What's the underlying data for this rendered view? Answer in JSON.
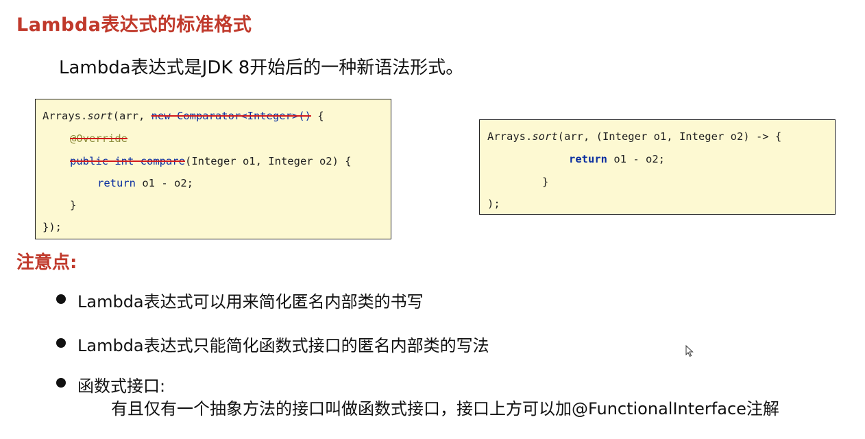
{
  "heading": "Lambda表达式的标准格式",
  "intro": "Lambda表达式是JDK 8开始后的一种新语法形式。",
  "code_left": {
    "l1_a": "Arrays.",
    "l1_sort": "sort",
    "l1_b": "(arr, ",
    "l1_strike": "new Comparator<Integer>()",
    "l1_c": " {",
    "l2_override": "@Override",
    "l3_strike": "public int compare",
    "l3_rest": "(Integer o1, Integer o2) {",
    "l4_return": "return",
    "l4_rest": " o1 - o2;",
    "l5": "}",
    "l6": "});"
  },
  "code_right": {
    "l1_a": "Arrays.",
    "l1_sort": "sort",
    "l1_b": "(arr, (Integer o1, Integer o2) -> {",
    "l2_return": "return",
    "l2_rest": " o1 - o2;",
    "l3": "}",
    "l4": ");"
  },
  "notes": {
    "title": "注意点:",
    "items": [
      "Lambda表达式可以用来简化匿名内部类的书写",
      "Lambda表达式只能简化函数式接口的匿名内部类的写法",
      "函数式接口:"
    ],
    "sub": "有且仅有一个抽象方法的接口叫做函数式接口，接口上方可以加@FunctionalInterface注解"
  }
}
